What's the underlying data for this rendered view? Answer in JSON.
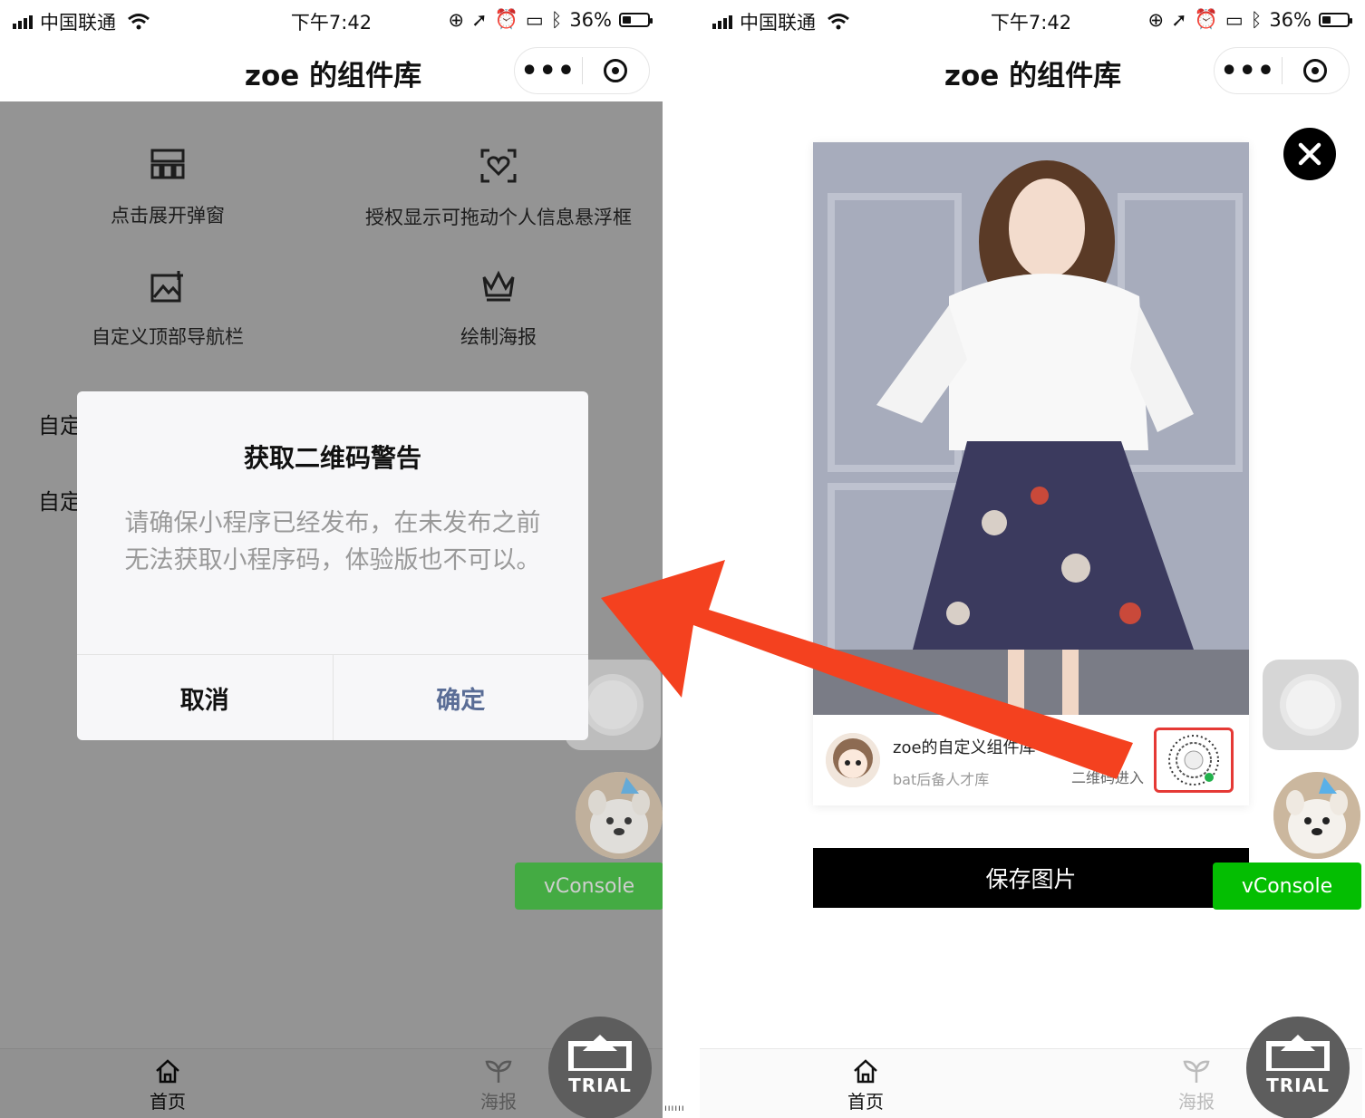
{
  "status_bar": {
    "carrier": "中国联通",
    "time": "下午7:42",
    "battery_text": "36%",
    "battery_fraction": 0.36
  },
  "nav": {
    "title": "zoe 的组件库",
    "more_label": "•••"
  },
  "left_screen": {
    "grid": [
      {
        "label": "点击展开弹窗",
        "icon": "grid-icon"
      },
      {
        "label": "授权显示可拖动个人信息悬浮框",
        "icon": "heart-scan-icon"
      },
      {
        "label": "自定义顶部导航栏",
        "icon": "image-add-icon"
      },
      {
        "label": "绘制海报",
        "icon": "crown-icon"
      }
    ],
    "list": [
      "自定",
      "自定"
    ],
    "dialog": {
      "title": "获取二维码警告",
      "message": "请确保小程序已经发布，在未发布之前无法获取小程序码，体验版也不可以。",
      "cancel": "取消",
      "confirm": "确定"
    }
  },
  "right_screen": {
    "poster": {
      "name": "zoe的自定义组件库",
      "subtitle": "bat后备人才库",
      "qr_hint": "二维码进入"
    },
    "save_button": "保存图片"
  },
  "floating": {
    "vconsole": "vConsole",
    "trial": "TRIAL"
  },
  "tabbar": {
    "home": "首页",
    "poster": "海报"
  },
  "colors": {
    "vconsole_green": "#04be02",
    "dialog_confirm": "#5a6d96",
    "arrow": "#f4411f",
    "qr_highlight": "#e53935"
  }
}
